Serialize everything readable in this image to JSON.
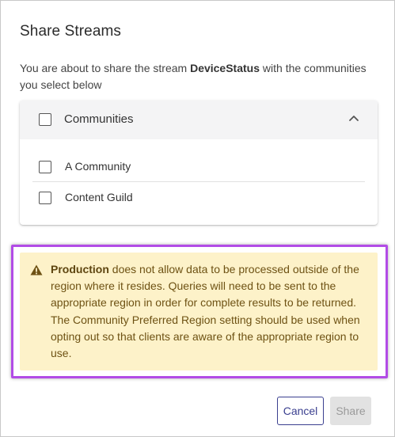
{
  "dialog": {
    "title": "Share Streams",
    "description": {
      "prefix": "You are about to share the stream ",
      "stream_name": "DeviceStatus",
      "suffix": " with the communities you select below"
    }
  },
  "communities_panel": {
    "header_label": "Communities",
    "header_checked": false,
    "expanded_icon": "chevron-up-icon",
    "items": [
      {
        "label": "A Community",
        "checked": false
      },
      {
        "label": "Content Guild",
        "checked": false
      }
    ]
  },
  "warning": {
    "icon": "warning-icon",
    "bold_text": "Production",
    "text": " does not allow data to be processed outside of the region where it resides. Queries will need to be sent to the appropriate region in order for complete results to be returned. The Community Preferred Region setting should be used when opting out so that clients are aware of the appropriate region to use.",
    "highlight_color": "#b24ce6",
    "background_color": "#fdf2c9"
  },
  "actions": {
    "cancel_label": "Cancel",
    "share_label": "Share",
    "share_enabled": false,
    "accent_color": "#3a3f8f"
  }
}
